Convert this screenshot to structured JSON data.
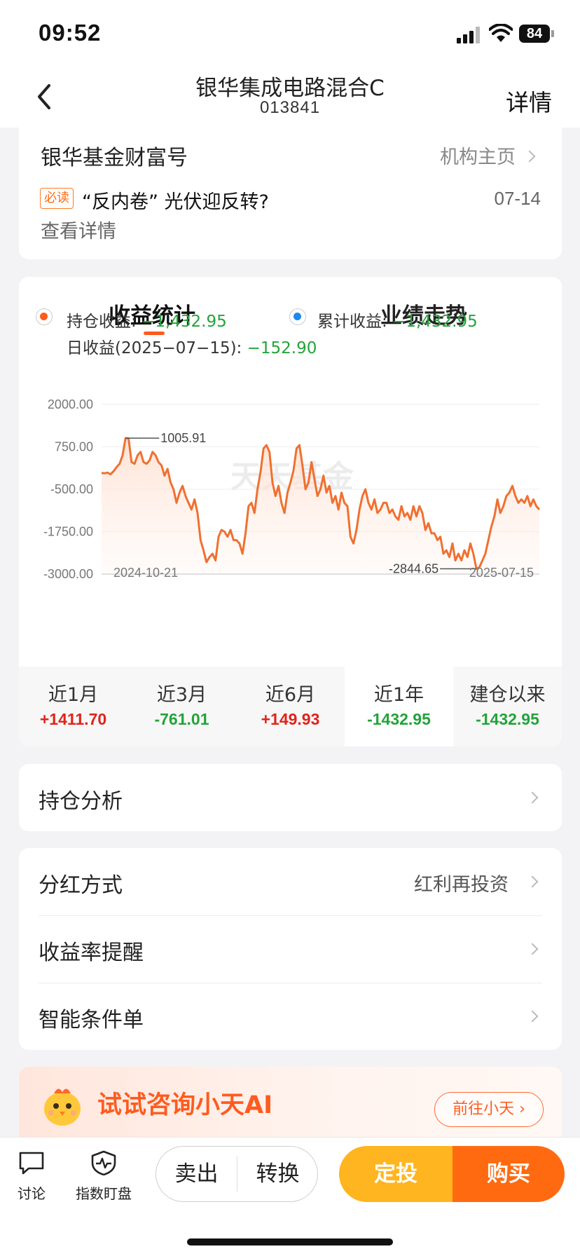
{
  "status": {
    "time": "09:52",
    "battery": "84"
  },
  "nav": {
    "title": "银华集成电路混合C",
    "code": "013841",
    "detail_label": "详情"
  },
  "info_card": {
    "title": "银华基金财富号",
    "link": "机构主页",
    "badge": "必读",
    "news": "“反内卷” 光伏迎反转?",
    "date": "07-14",
    "more": "查看详情"
  },
  "tabs": {
    "active": "收益统计",
    "inactive": "业绩走势"
  },
  "legend": {
    "holding_label": "持仓收益:",
    "holding_value": "−1,432.95",
    "holding_color": "#ff5a1f",
    "cumulative_label": "累计收益:",
    "cumulative_value": "−1,432.95",
    "cumulative_color": "#1e88f0",
    "daily_label": "日收益(2025−07−15):",
    "daily_value": "−152.90"
  },
  "chart_data": {
    "type": "line",
    "y_ticks": [
      "2000.00",
      "750.00",
      "-500.00",
      "-1750.00",
      "-3000.00"
    ],
    "ylim": [
      -3000,
      2000
    ],
    "x_start": "2024-10-21",
    "x_end": "2025-07-15",
    "max_annotation": "1005.91",
    "min_annotation": "-2844.65",
    "watermark": "天天基金",
    "line_color": "#f07030",
    "series": [
      {
        "values": [
          -20,
          -30,
          -10,
          -60,
          30,
          150,
          250,
          500,
          1005.91,
          1000,
          300,
          250,
          500,
          600,
          300,
          250,
          350,
          600,
          500,
          300,
          200,
          -100,
          100,
          -300,
          -500,
          -900,
          -600,
          -400,
          -700,
          -900,
          -1100,
          -800,
          -1200,
          -2000,
          -2300,
          -2650,
          -2500,
          -2400,
          -2600,
          -1900,
          -1700,
          -1750,
          -1900,
          -1700,
          -2000,
          -2000,
          -2100,
          -2400,
          -1800,
          -1000,
          -900,
          -1200,
          -500,
          0,
          700,
          800,
          600,
          -300,
          -700,
          -400,
          -900,
          -1200,
          -600,
          -300,
          50,
          700,
          800,
          200,
          -500,
          -300,
          300,
          -200,
          -700,
          -500,
          -100,
          -600,
          -400,
          -900,
          -700,
          -1100,
          -600,
          -900,
          -1000,
          -1900,
          -2100,
          -1700,
          -1100,
          -700,
          -500,
          -900,
          -1100,
          -800,
          -1200,
          -1100,
          -900,
          -900,
          -1200,
          -1100,
          -1300,
          -1400,
          -1000,
          -1300,
          -1200,
          -1400,
          -1000,
          -1300,
          -1000,
          -1200,
          -1700,
          -1500,
          -1800,
          -1800,
          -2000,
          -1900,
          -2400,
          -2300,
          -2500,
          -2100,
          -2600,
          -2400,
          -2600,
          -2300,
          -2500,
          -2100,
          -2400,
          -2844.65,
          -2800,
          -2600,
          -2400,
          -2000,
          -1600,
          -1300,
          -800,
          -1200,
          -1000,
          -700,
          -600,
          -400,
          -700,
          -900,
          -800,
          -900,
          -700,
          -1000,
          -800,
          -1000,
          -1100
        ]
      }
    ]
  },
  "periods": [
    {
      "label": "近1月",
      "value": "+1411.70",
      "tone": "red"
    },
    {
      "label": "近3月",
      "value": "-761.01",
      "tone": "green"
    },
    {
      "label": "近6月",
      "value": "+149.93",
      "tone": "red"
    },
    {
      "label": "近1年",
      "value": "-1432.95",
      "tone": "green"
    },
    {
      "label": "建仓以来",
      "value": "-1432.95",
      "tone": "green"
    }
  ],
  "holdings": {
    "label": "持仓分析"
  },
  "settings": {
    "dividend_label": "分红方式",
    "dividend_value": "红利再投资",
    "yield_alert": "收益率提醒",
    "smart_order": "智能条件单"
  },
  "ai": {
    "text": "试试咨询小天AI",
    "button": "前往小天"
  },
  "bottom": {
    "discuss": "讨论",
    "watch": "指数盯盘",
    "sell": "卖出",
    "convert": "转换",
    "dca": "定投",
    "buy": "购买"
  }
}
